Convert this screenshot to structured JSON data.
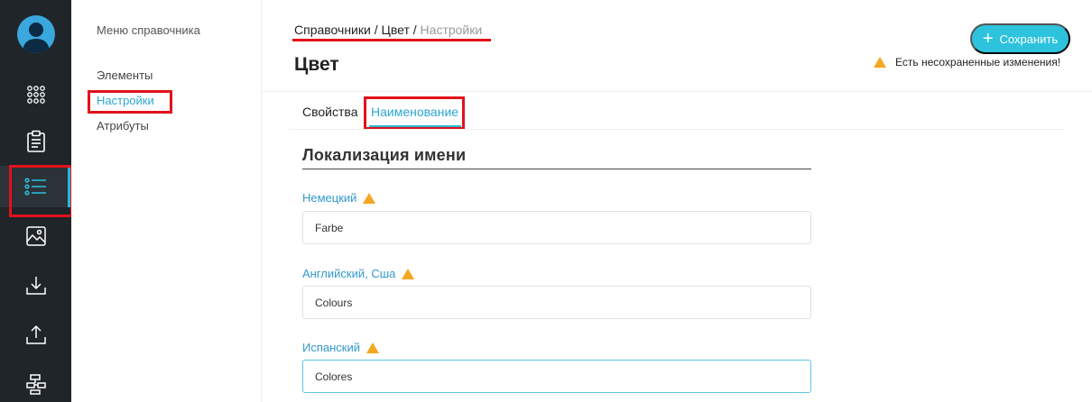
{
  "submenu": {
    "title": "Меню справочника",
    "items": [
      {
        "label": "Элементы"
      },
      {
        "label": "Настройки"
      },
      {
        "label": "Атрибуты"
      }
    ]
  },
  "rail": {
    "icons": [
      "avatar",
      "apps-grid-icon",
      "clipboard-icon",
      "list-icon",
      "image-icon",
      "download-icon",
      "upload-icon",
      "sitemap-icon"
    ],
    "active": "list-icon"
  },
  "breadcrumb": {
    "item1": "Справочники",
    "sep": "/",
    "item2": "Цвет",
    "current": "Настройки"
  },
  "page": {
    "title": "Цвет",
    "save_label": "Сохранить",
    "unsaved_text": "Есть несохраненные изменения!"
  },
  "tabs": [
    {
      "label": "Свойства"
    },
    {
      "label": "Наименование"
    }
  ],
  "section": {
    "title": "Локализация имени"
  },
  "fields": [
    {
      "label": "Немецкий",
      "value": "Farbe"
    },
    {
      "label": "Английский, Сша",
      "value": "Colours"
    },
    {
      "label": "Испанский",
      "value": "Colores"
    }
  ],
  "colors": {
    "rail_bg": "#1f2529",
    "accent": "#2ec3dd",
    "link": "#2ba6d3",
    "warning": "#f5a623",
    "highlight": "#e3111b"
  }
}
